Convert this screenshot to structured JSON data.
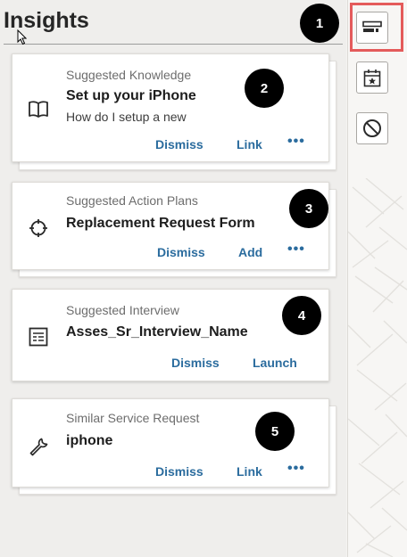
{
  "panel": {
    "title": "Insights"
  },
  "rail": {
    "buttons": [
      {
        "icon": "insights-icon",
        "highlighted": true
      },
      {
        "icon": "calendar-star-icon"
      },
      {
        "icon": "block-icon"
      }
    ],
    "highlight_color": "#e45b5b"
  },
  "cards": [
    {
      "kind": "Suggested Knowledge",
      "name": "Set up your iPhone",
      "description": "How do I setup a new",
      "icon": "book-icon",
      "actions": [
        "Dismiss",
        "Link"
      ],
      "more": "•••"
    },
    {
      "kind": "Suggested Action Plans",
      "name": "Replacement Request Form",
      "icon": "crosshair-icon",
      "actions": [
        "Dismiss",
        "Add"
      ],
      "more": "•••"
    },
    {
      "kind": "Suggested Interview",
      "name": "Asses_Sr_Interview_Name",
      "icon": "interview-form-icon",
      "actions": [
        "Dismiss",
        "Launch"
      ]
    },
    {
      "kind": "Similar Service Request",
      "name": "iphone",
      "icon": "wrench-icon",
      "actions": [
        "Dismiss",
        "Link"
      ],
      "more": "•••"
    }
  ],
  "callouts": [
    "1",
    "2",
    "3",
    "4",
    "5"
  ],
  "colors": {
    "action": "#2b6c9e",
    "background": "#efeeec",
    "card": "#ffffff"
  }
}
